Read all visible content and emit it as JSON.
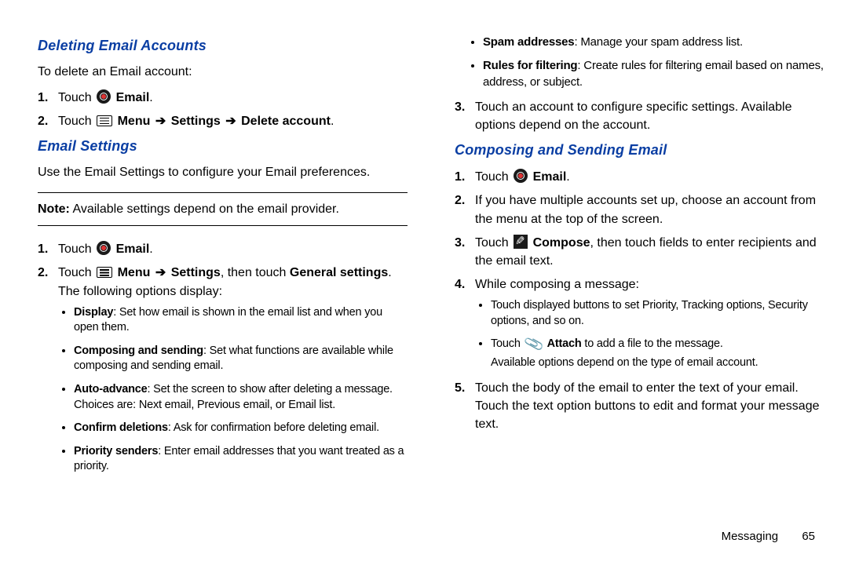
{
  "left": {
    "h1": "Deleting Email Accounts",
    "intro1": "To delete an Email account:",
    "s1_num": "1.",
    "s1_touch": "Touch ",
    "s1_email": "Email",
    "s2_num": "2.",
    "s2_touch": "Touch ",
    "s2_menu": "Menu",
    "s2_settings": "Settings",
    "s2_delete": "Delete account",
    "h2": "Email Settings",
    "intro2": "Use the Email Settings to configure your Email preferences.",
    "note_label": "Note:",
    "note_text": " Available settings depend on the email provider.",
    "es1_num": "1.",
    "es1_touch": "Touch ",
    "es1_email": "Email",
    "es2_num": "2.",
    "es2_touch": "Touch ",
    "es2_menu": "Menu",
    "es2_settings": "Settings",
    "es2_then": ", then touch ",
    "es2_general": "General settings",
    "es2_after": ". The following options display:",
    "b1_lbl": "Display",
    "b1_txt": ": Set how email is shown in the email list and when you open them.",
    "b2_lbl": "Composing and sending",
    "b2_txt": ": Set what functions are available while composing and sending email.",
    "b3_lbl": "Auto-advance",
    "b3_txt": ": Set the screen to show after deleting a message. Choices are: Next email, Previous email, or Email list.",
    "b4_lbl": "Confirm deletions",
    "b4_txt": ": Ask for confirmation before deleting email.",
    "b5_lbl": "Priority senders",
    "b5_txt": ": Enter email addresses that you want treated as a priority."
  },
  "right": {
    "rb1_lbl": "Spam addresses",
    "rb1_txt": ": Manage your spam address list.",
    "rb2_lbl": "Rules for filtering",
    "rb2_txt": ": Create rules for filtering email based on names, address, or subject.",
    "r3_num": "3.",
    "r3_txt": "Touch an account to configure specific settings. Available options depend on the account.",
    "h3": "Composing and Sending Email",
    "c1_num": "1.",
    "c1_touch": "Touch ",
    "c1_email": "Email",
    "c2_num": "2.",
    "c2_txt": "If you have multiple accounts set up, choose an account from the menu at the top of the screen.",
    "c3_num": "3.",
    "c3_touch": "Touch ",
    "c3_compose": "Compose",
    "c3_after": ", then touch fields to enter recipients and the email text.",
    "c4_num": "4.",
    "c4_txt": "While composing a message:",
    "c4b1": "Touch displayed buttons to set Priority, Tracking options, Security options, and so on.",
    "c4b2_pre": "Touch ",
    "c4b2_attach": "Attach",
    "c4b2_post": " to add a file to the message.",
    "c4b2_note": "Available options depend on the type of email account.",
    "c5_num": "5.",
    "c5_txt": "Touch the body of the email to enter the text of your email. Touch the text option buttons to edit and format your message text."
  },
  "arrow": "➔",
  "footer": {
    "section": "Messaging",
    "page": "65"
  }
}
